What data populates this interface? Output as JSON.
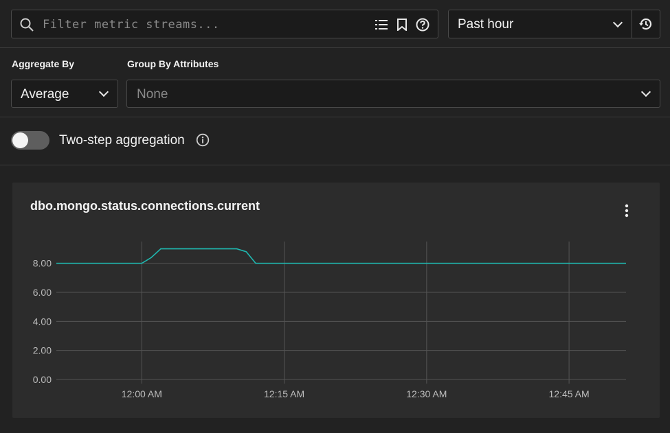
{
  "filter": {
    "placeholder": "Filter metric streams..."
  },
  "time_range": {
    "selected": "Past hour"
  },
  "aggregate_by": {
    "label": "Aggregate By",
    "selected": "Average"
  },
  "group_by": {
    "label": "Group By Attributes",
    "placeholder": "None"
  },
  "two_step": {
    "label": "Two-step aggregation",
    "enabled": false
  },
  "chart_panel": {
    "title": "dbo.mongo.status.connections.current"
  },
  "colors": {
    "line": "#1fb8b0",
    "background": "#222222",
    "panel": "#2c2c2c"
  },
  "icons": [
    "search-icon",
    "list-icon",
    "bookmark-icon",
    "help-icon",
    "chevron-down-icon",
    "history-icon",
    "info-icon",
    "more-vertical-icon"
  ],
  "chart_data": {
    "type": "line",
    "title": "dbo.mongo.status.connections.current",
    "xlabel": "",
    "ylabel": "",
    "ylim": [
      0,
      9.5
    ],
    "yticks": [
      "0.00",
      "2.00",
      "4.00",
      "6.00",
      "8.00"
    ],
    "xticks": [
      "12:00 AM",
      "12:15 AM",
      "12:30 AM",
      "12:45 AM"
    ],
    "xlim": [
      "11:51 PM",
      "12:51 AM"
    ],
    "grid": true,
    "series": [
      {
        "x": [
          "11:51 PM",
          "12:00 AM",
          "12:01 AM",
          "12:02 AM",
          "12:10 AM",
          "12:11 AM",
          "12:12 AM",
          "12:51 AM"
        ],
        "values": [
          8,
          8,
          8.4,
          9,
          9,
          8.8,
          8,
          8
        ]
      }
    ]
  }
}
